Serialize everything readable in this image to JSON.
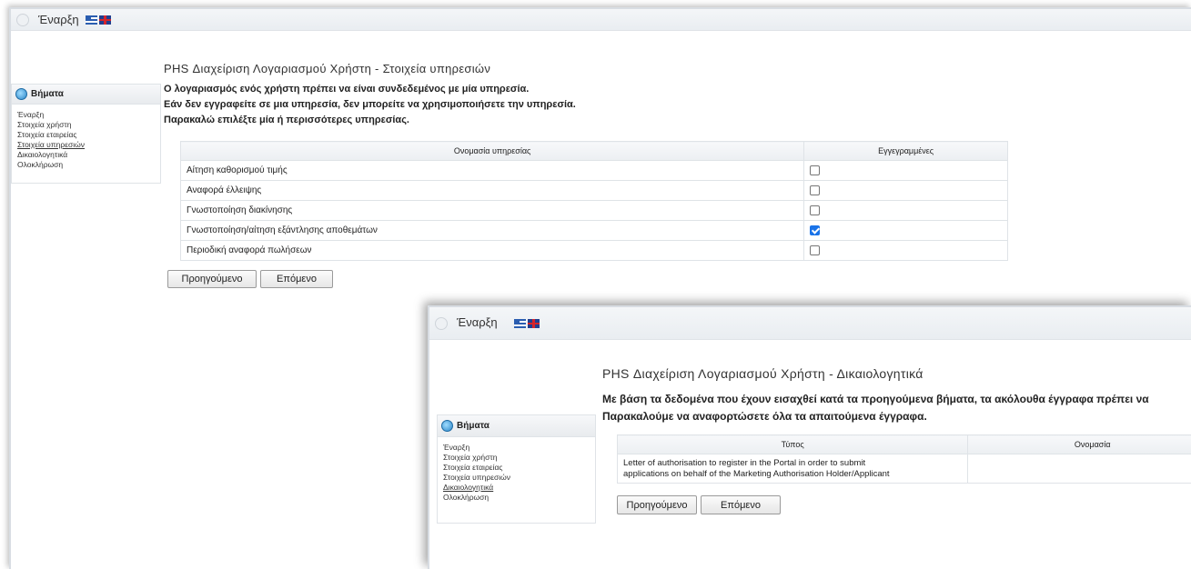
{
  "window1": {
    "topbar": {
      "start_label": "Έναρξη"
    },
    "sidebar": {
      "heading": "Βήματα",
      "items": [
        {
          "label": "Έναρξη"
        },
        {
          "label": "Στοιχεία χρήστη"
        },
        {
          "label": "Στοιχεία εταιρείας"
        },
        {
          "label": "Στοιχεία υπηρεσιών"
        },
        {
          "label": "Δικαιολογητικά"
        },
        {
          "label": "Ολοκλήρωση"
        }
      ]
    },
    "title": "PHS Διαχείριση Λογαριασμού Χρήστη - Στοιχεία υπηρεσιών",
    "intro": [
      "Ο λογαριασμός ενός χρήστη πρέπει να είναι συνδεδεμένος με μία υπηρεσία.",
      "Εάν δεν εγγραφείτε σε μια υπηρεσία, δεν μπορείτε να χρησιμοποιήσετε την υπηρεσία.",
      "Παρακαλώ επιλέξτε μία ή περισσότερες υπηρεσίας."
    ],
    "table": {
      "headers": [
        "Ονομασία υπηρεσίας",
        "Εγγεγραμμένες"
      ],
      "rows": [
        {
          "name": "Αίτηση καθορισμού τιμής",
          "checked": false
        },
        {
          "name": "Αναφορά έλλειψης",
          "checked": false
        },
        {
          "name": "Γνωστοποίηση διακίνησης",
          "checked": false
        },
        {
          "name": "Γνωστοποίηση/αίτηση εξάντλησης αποθεμάτων",
          "checked": true
        },
        {
          "name": "Περιοδική αναφορά πωλήσεων",
          "checked": false
        }
      ]
    },
    "buttons": {
      "prev": "Προηγούμενο",
      "next": "Επόμενο"
    }
  },
  "window2": {
    "topbar": {
      "start_label": "Έναρξη"
    },
    "sidebar": {
      "heading": "Βήματα",
      "items": [
        {
          "label": "Έναρξη"
        },
        {
          "label": "Στοιχεία χρήστη"
        },
        {
          "label": "Στοιχεία εταιρείας"
        },
        {
          "label": "Στοιχεία υπηρεσιών"
        },
        {
          "label": "Δικαιολογητικά"
        },
        {
          "label": "Ολοκλήρωση"
        }
      ]
    },
    "title": "PHS Διαχείριση Λογαριασμού Χρήστη - Δικαιολογητικά",
    "intro": [
      "Με βάση τα δεδομένα που έχουν εισαχθεί κατά τα προηγούμενα βήματα, τα ακόλουθα έγγραφα πρέπει να",
      "Παρακαλούμε να αναφορτώσετε όλα τα απαιτούμενα έγγραφα."
    ],
    "table": {
      "headers": [
        "Τύπος",
        "Ονομασία"
      ],
      "rows": [
        {
          "type_line1": "Letter of authorisation to register in the Portal in order to submit",
          "type_line2": "applications on behalf of the Marketing Authorisation Holder/Applicant",
          "name": ""
        }
      ]
    },
    "buttons": {
      "prev": "Προηγούμενο",
      "next": "Επόμενο"
    }
  }
}
